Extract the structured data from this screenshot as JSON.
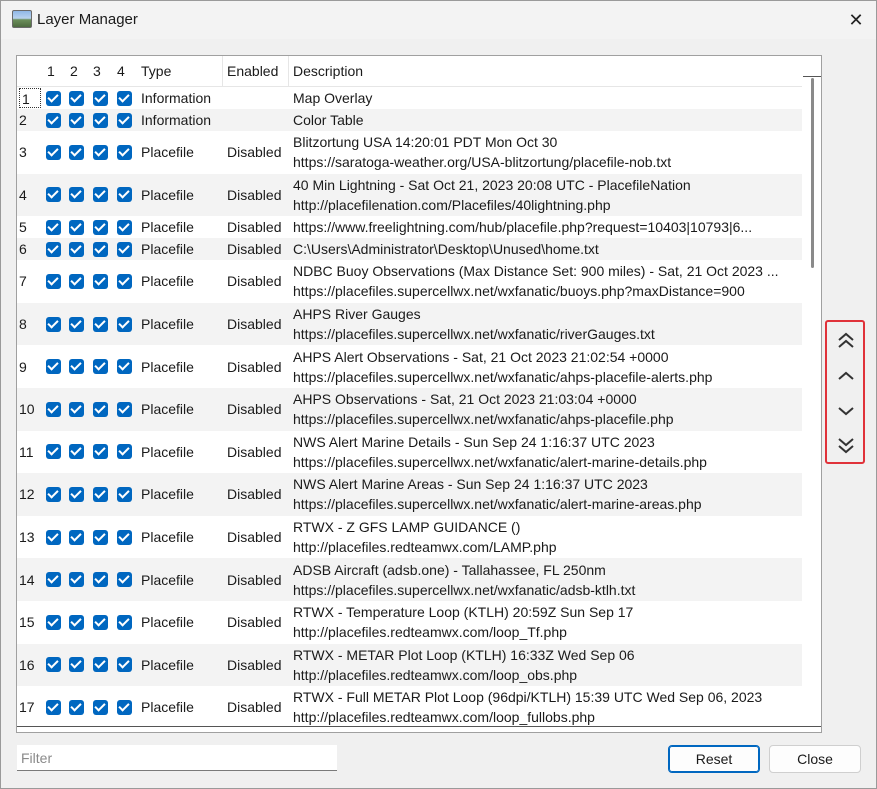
{
  "window": {
    "title": "Layer Manager"
  },
  "columns": {
    "c1": "1",
    "c2": "2",
    "c3": "3",
    "c4": "4",
    "type": "Type",
    "enabled": "Enabled",
    "description": "Description"
  },
  "rows": [
    {
      "num": "1",
      "checks": [
        true,
        true,
        true,
        true
      ],
      "type": "Information",
      "enabled": "",
      "desc": [
        "Map Overlay"
      ]
    },
    {
      "num": "2",
      "checks": [
        true,
        true,
        true,
        true
      ],
      "type": "Information",
      "enabled": "",
      "desc": [
        "Color Table"
      ]
    },
    {
      "num": "3",
      "checks": [
        true,
        true,
        true,
        true
      ],
      "type": "Placefile",
      "enabled": "Disabled",
      "desc": [
        "Blitzortung USA 14:20:01 PDT Mon Oct 30",
        "https://saratoga-weather.org/USA-blitzortung/placefile-nob.txt"
      ]
    },
    {
      "num": "4",
      "checks": [
        true,
        true,
        true,
        true
      ],
      "type": "Placefile",
      "enabled": "Disabled",
      "desc": [
        "40 Min Lightning - Sat Oct 21, 2023 20:08 UTC - PlacefileNation",
        "http://placefilenation.com/Placefiles/40lightning.php"
      ]
    },
    {
      "num": "5",
      "checks": [
        true,
        true,
        true,
        true
      ],
      "type": "Placefile",
      "enabled": "Disabled",
      "desc": [
        "https://www.freelightning.com/hub/placefile.php?request=10403|10793|6..."
      ]
    },
    {
      "num": "6",
      "checks": [
        true,
        true,
        true,
        true
      ],
      "type": "Placefile",
      "enabled": "Disabled",
      "desc": [
        "C:\\Users\\Administrator\\Desktop\\Unused\\home.txt"
      ]
    },
    {
      "num": "7",
      "checks": [
        true,
        true,
        true,
        true
      ],
      "type": "Placefile",
      "enabled": "Disabled",
      "desc": [
        "NDBC Buoy Observations (Max Distance Set: 900 miles) - Sat, 21 Oct 2023 ...",
        "https://placefiles.supercellwx.net/wxfanatic/buoys.php?maxDistance=900"
      ]
    },
    {
      "num": "8",
      "checks": [
        true,
        true,
        true,
        true
      ],
      "type": "Placefile",
      "enabled": "Disabled",
      "desc": [
        "AHPS River Gauges",
        "https://placefiles.supercellwx.net/wxfanatic/riverGauges.txt"
      ]
    },
    {
      "num": "9",
      "checks": [
        true,
        true,
        true,
        true
      ],
      "type": "Placefile",
      "enabled": "Disabled",
      "desc": [
        "AHPS Alert Observations - Sat, 21 Oct 2023 21:02:54 +0000",
        "https://placefiles.supercellwx.net/wxfanatic/ahps-placefile-alerts.php"
      ]
    },
    {
      "num": "10",
      "checks": [
        true,
        true,
        true,
        true
      ],
      "type": "Placefile",
      "enabled": "Disabled",
      "desc": [
        "AHPS Observations - Sat, 21 Oct 2023 21:03:04 +0000",
        "https://placefiles.supercellwx.net/wxfanatic/ahps-placefile.php"
      ]
    },
    {
      "num": "11",
      "checks": [
        true,
        true,
        true,
        true
      ],
      "type": "Placefile",
      "enabled": "Disabled",
      "desc": [
        "NWS Alert Marine Details - Sun Sep 24 1:16:37 UTC 2023",
        "https://placefiles.supercellwx.net/wxfanatic/alert-marine-details.php"
      ]
    },
    {
      "num": "12",
      "checks": [
        true,
        true,
        true,
        true
      ],
      "type": "Placefile",
      "enabled": "Disabled",
      "desc": [
        "NWS Alert Marine Areas - Sun Sep 24 1:16:37 UTC 2023",
        "https://placefiles.supercellwx.net/wxfanatic/alert-marine-areas.php"
      ]
    },
    {
      "num": "13",
      "checks": [
        true,
        true,
        true,
        true
      ],
      "type": "Placefile",
      "enabled": "Disabled",
      "desc": [
        "RTWX - Z GFS LAMP GUIDANCE ()",
        "http://placefiles.redteamwx.com/LAMP.php"
      ]
    },
    {
      "num": "14",
      "checks": [
        true,
        true,
        true,
        true
      ],
      "type": "Placefile",
      "enabled": "Disabled",
      "desc": [
        "ADSB Aircraft (adsb.one) - Tallahassee, FL 250nm",
        "https://placefiles.supercellwx.net/wxfanatic/adsb-ktlh.txt"
      ]
    },
    {
      "num": "15",
      "checks": [
        true,
        true,
        true,
        true
      ],
      "type": "Placefile",
      "enabled": "Disabled",
      "desc": [
        "RTWX - Temperature Loop (KTLH) 20:59Z Sun Sep 17",
        "http://placefiles.redteamwx.com/loop_Tf.php"
      ]
    },
    {
      "num": "16",
      "checks": [
        true,
        true,
        true,
        true
      ],
      "type": "Placefile",
      "enabled": "Disabled",
      "desc": [
        "RTWX - METAR Plot Loop (KTLH) 16:33Z Wed Sep 06",
        "http://placefiles.redteamwx.com/loop_obs.php"
      ]
    },
    {
      "num": "17",
      "checks": [
        true,
        true,
        true,
        true
      ],
      "type": "Placefile",
      "enabled": "Disabled",
      "desc": [
        "RTWX - Full METAR Plot Loop (96dpi/KTLH) 15:39 UTC Wed Sep 06, 2023",
        "http://placefiles.redteamwx.com/loop_fullobs.php"
      ]
    }
  ],
  "move_buttons": {
    "top_icon": "double-chevron-up-icon",
    "up_icon": "chevron-up-icon",
    "down_icon": "chevron-down-icon",
    "bottom_icon": "double-chevron-down-icon"
  },
  "filter": {
    "value": "",
    "placeholder": "Filter"
  },
  "buttons": {
    "reset": "Reset",
    "close": "Close"
  },
  "colors": {
    "checkbox": "#0067c0",
    "highlight_border": "#e0323a",
    "alt_row": "#f3f3f3"
  }
}
